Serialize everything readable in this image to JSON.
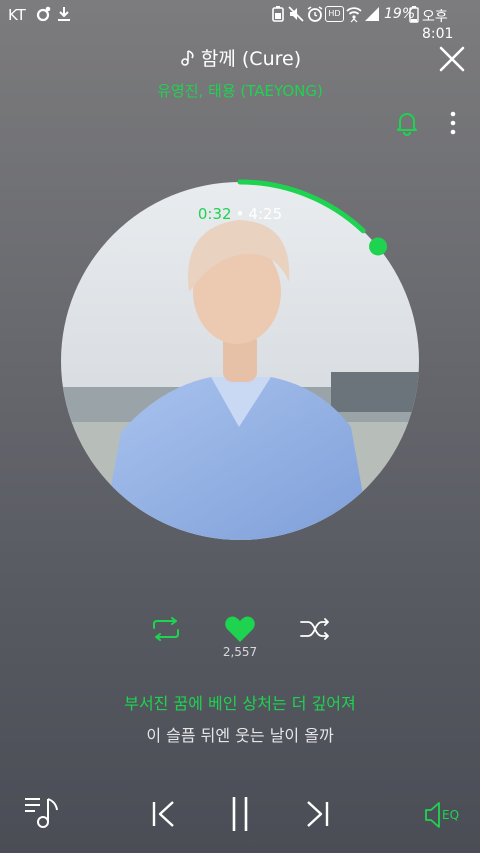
{
  "status_bar": {
    "carrier": "KT",
    "battery": "19%",
    "time": "오후 8:01",
    "hd_label": "HD"
  },
  "header": {
    "song_title": "함께 (Cure)",
    "artist": "유영진, 태용 (TAEYONG)"
  },
  "player": {
    "current_time": "0:32",
    "separator": "•",
    "total_time": "4:25",
    "progress": 0.12,
    "like_count": "2,557",
    "eq_label": "EQ"
  },
  "lyrics": {
    "current_line": "부서진 꿈에 베인 상처는 더 깊어져",
    "next_line": "이 슬픔 뒤엔 웃는 날이 올까"
  },
  "colors": {
    "accent": "#1ed34f",
    "background_top": "#7c7c7e",
    "background_bottom": "#4b4d56"
  }
}
